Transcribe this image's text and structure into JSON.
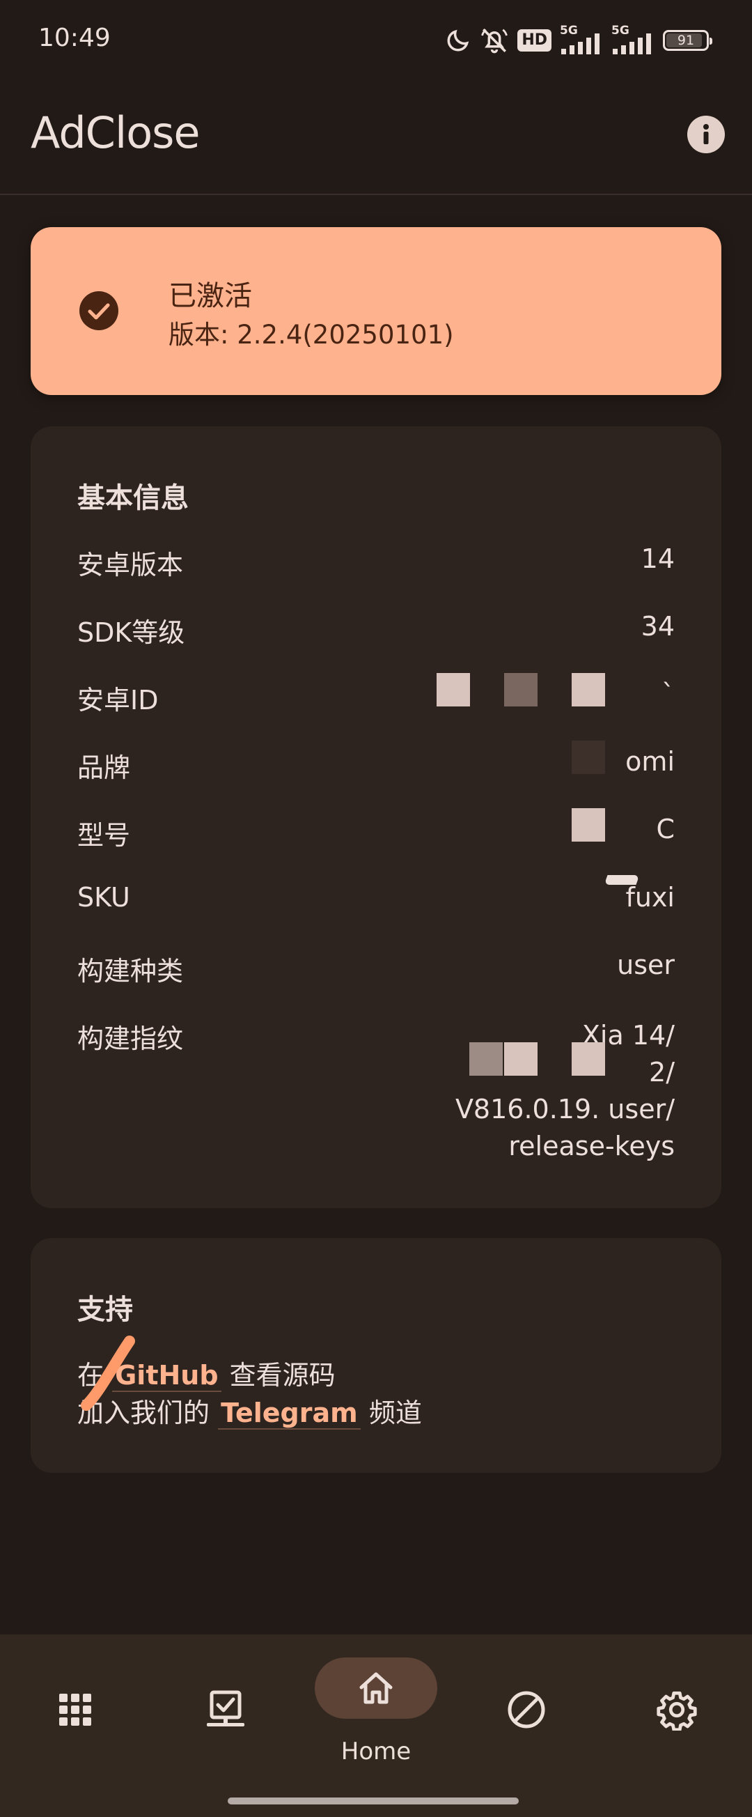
{
  "status_bar": {
    "time": "10:49",
    "hd_badge": "HD",
    "network_1": "5G",
    "network_2": "5G",
    "battery": "91",
    "battery_level": 0.91,
    "icons": [
      "moon-icon",
      "bell-off-icon",
      "hd-icon",
      "signal-icon",
      "signal-icon",
      "battery-icon"
    ]
  },
  "app_bar": {
    "title": "AdClose",
    "info_icon": "info-icon"
  },
  "activation": {
    "title": "已激活",
    "version": "版本: 2.2.4(20250101)",
    "icon": "check-circle-icon",
    "color": "#ffb28e"
  },
  "basic_info": {
    "title": "基本信息",
    "rows": [
      {
        "label": "安卓版本",
        "value": "14"
      },
      {
        "label": "SDK等级",
        "value": "34"
      },
      {
        "label": "安卓ID",
        "value": "`"
      },
      {
        "label": "品牌",
        "value": "omi"
      },
      {
        "label": "型号",
        "value": "C"
      },
      {
        "label": "SKU",
        "value": "fuxi"
      },
      {
        "label": "构建种类",
        "value": "user"
      },
      {
        "label": "构建指纹",
        "value_lines": [
          "Xia        14/",
          "2/",
          "V816.0.19.         user/",
          "release-keys"
        ]
      }
    ]
  },
  "support": {
    "title": "支持",
    "line1_prefix": "在",
    "line1_link": "GitHub",
    "line1_suffix": "查看源码",
    "line2_prefix": "加入我们的",
    "line2_link": "Telegram",
    "line2_suffix": "频道"
  },
  "bottom_nav": {
    "items": [
      {
        "icon": "apps-grid-icon",
        "label": ""
      },
      {
        "icon": "app-check-icon",
        "label": ""
      },
      {
        "icon": "home-icon",
        "label": "Home",
        "active": true
      },
      {
        "icon": "block-icon",
        "label": ""
      },
      {
        "icon": "gear-icon",
        "label": ""
      }
    ],
    "active_color": "#5c4336"
  }
}
